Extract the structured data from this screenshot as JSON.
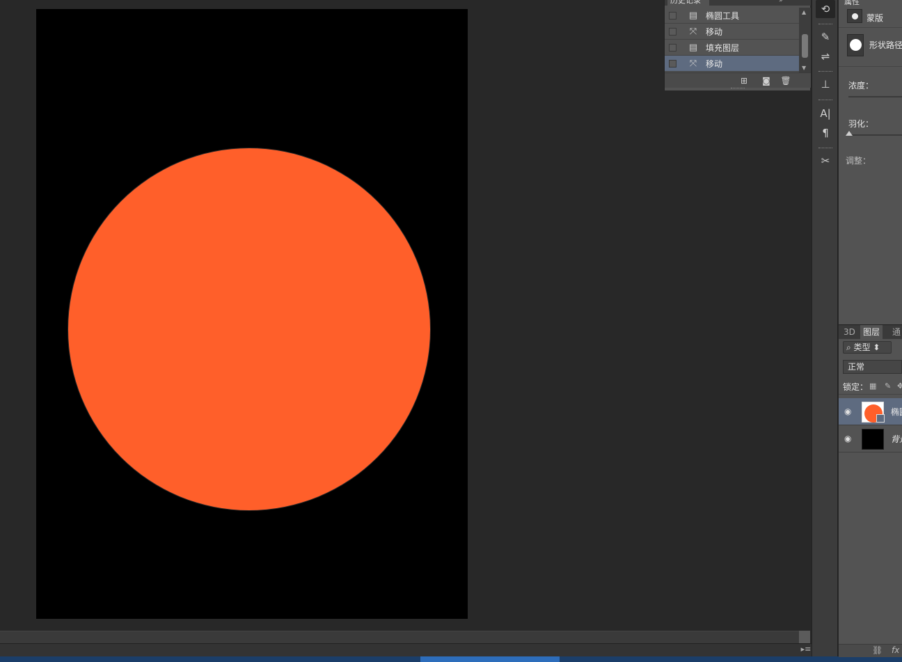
{
  "history": {
    "tab_title": "历史记录",
    "tab_extra": "»",
    "collapse_label": "—",
    "items": [
      {
        "icon": "document-icon",
        "glyph": "▤",
        "label": "椭圆工具",
        "selected": false
      },
      {
        "icon": "move-tool-icon",
        "glyph": "⤧",
        "label": "移动",
        "selected": false
      },
      {
        "icon": "document-icon",
        "glyph": "▤",
        "label": "填充图层",
        "selected": false
      },
      {
        "icon": "move-tool-icon",
        "glyph": "⤧",
        "label": "移动",
        "selected": true
      }
    ],
    "footer_new_doc": "⊞",
    "footer_snapshot": "◙",
    "footer_delete": "🗑"
  },
  "dock": {
    "items": [
      {
        "name": "history-dock-icon",
        "glyph": "⟲",
        "active": true
      },
      {
        "name": "brush-presets-dock-icon",
        "glyph": "✎",
        "active": false
      },
      {
        "name": "adjustments-dock-icon",
        "glyph": "⇌",
        "active": false
      },
      {
        "name": "clone-source-dock-icon",
        "glyph": "⊥",
        "active": false
      },
      {
        "name": "character-dock-icon",
        "glyph": "A|",
        "active": false
      },
      {
        "name": "paragraph-dock-icon",
        "glyph": "¶",
        "active": false
      },
      {
        "name": "tools-dock-icon",
        "glyph": "✂",
        "active": false
      }
    ]
  },
  "properties": {
    "tab_title": "属性",
    "mask_label": "蒙版",
    "shape_label": "形状路径",
    "density_label": "浓度：",
    "feather_label": "羽化：",
    "adjust_label": "调整："
  },
  "layers": {
    "tabs": [
      {
        "label": "3D",
        "active": false
      },
      {
        "label": "图层",
        "active": true
      },
      {
        "label": "通",
        "active": false
      }
    ],
    "filter_label": "⌕ 类型 ⬍",
    "blend_mode": "正常",
    "lock_label": "锁定：",
    "rows": [
      {
        "name": "椭圆",
        "visible_glyph": "◉",
        "selected": true,
        "kind": "shape"
      },
      {
        "name": "背景",
        "visible_glyph": "◉",
        "selected": false,
        "kind": "background"
      }
    ],
    "footer_link": "⛓",
    "footer_fx": "fx"
  },
  "status": {
    "menu_glyph": "▸≡"
  },
  "colors": {
    "ellipse_fill": "#ff5f2a",
    "document_bg": "#000000",
    "selection": "#5e6b80"
  }
}
